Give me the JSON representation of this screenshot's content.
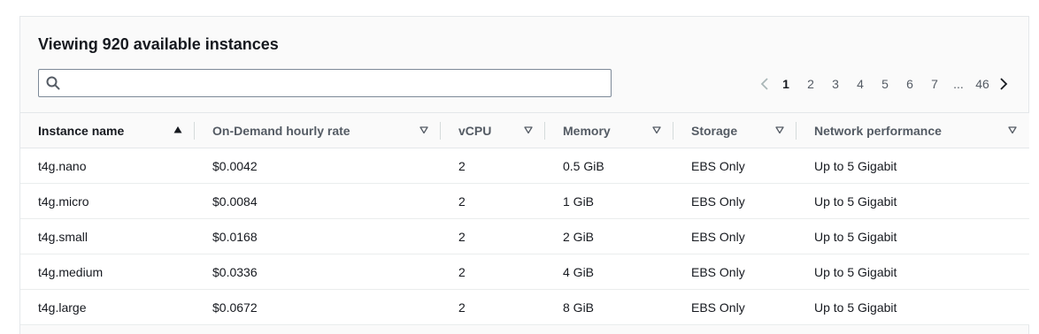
{
  "header": {
    "title": "Viewing 920 available instances"
  },
  "search": {
    "value": "",
    "placeholder": "",
    "icon": "search-icon"
  },
  "pagination": {
    "prev_icon": "chevron-left-icon",
    "next_icon": "chevron-right-icon",
    "pages": [
      "1",
      "2",
      "3",
      "4",
      "5",
      "6",
      "7"
    ],
    "current_page": "1",
    "ellipsis": "...",
    "last_page": "46"
  },
  "table": {
    "columns": [
      {
        "label": "Instance name",
        "sort": "ascending"
      },
      {
        "label": "On-Demand hourly rate",
        "sort": "none"
      },
      {
        "label": "vCPU",
        "sort": "none"
      },
      {
        "label": "Memory",
        "sort": "none"
      },
      {
        "label": "Storage",
        "sort": "none"
      },
      {
        "label": "Network performance",
        "sort": "none"
      }
    ],
    "rows": [
      [
        "t4g.nano",
        "$0.0042",
        "2",
        "0.5 GiB",
        "EBS Only",
        "Up to 5 Gigabit"
      ],
      [
        "t4g.micro",
        "$0.0084",
        "2",
        "1 GiB",
        "EBS Only",
        "Up to 5 Gigabit"
      ],
      [
        "t4g.small",
        "$0.0168",
        "2",
        "2 GiB",
        "EBS Only",
        "Up to 5 Gigabit"
      ],
      [
        "t4g.medium",
        "$0.0336",
        "2",
        "4 GiB",
        "EBS Only",
        "Up to 5 Gigabit"
      ],
      [
        "t4g.large",
        "$0.0672",
        "2",
        "8 GiB",
        "EBS Only",
        "Up to 5 Gigabit"
      ]
    ]
  },
  "colors": {
    "border": "#e4e7ea",
    "text": "#16191f",
    "muted": "#545b64",
    "header_bg": "#fafafa"
  }
}
